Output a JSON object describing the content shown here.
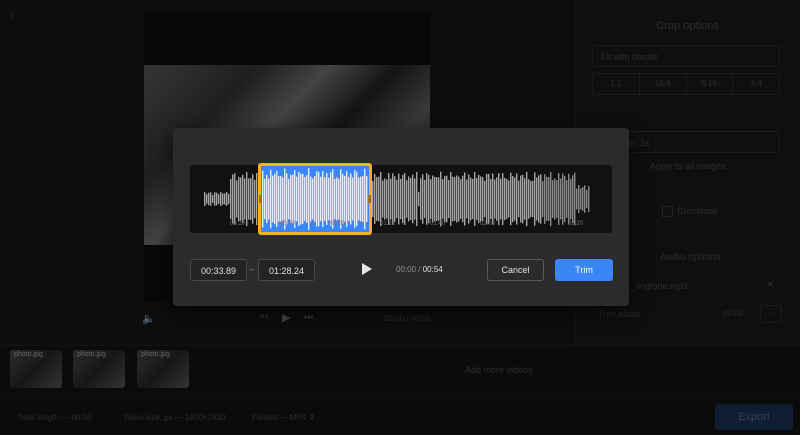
{
  "background": {
    "crop": {
      "title": "Crop options",
      "fit_select": "Fit with border",
      "ratios": [
        "1:1",
        "16:9",
        "9:16",
        "3:4"
      ]
    },
    "slide": {
      "duration_select": "Duration: 2s",
      "apply_all": "Apply to all images",
      "crossfade": "Crossfade"
    },
    "audio": {
      "title": "Audio options",
      "file": "Marimba_ringtone.mp3",
      "trim_row": "Trim audio",
      "trim_time": "00:00",
      "more_button": "..."
    },
    "player": {
      "current": "00:00",
      "total": "00:06"
    },
    "timeline": {
      "thumbs": [
        "photo.jpg",
        "photo.jpg",
        "photo.jpg"
      ],
      "add_more": "Add more videos"
    },
    "footer": {
      "total_length_label": "Total length —",
      "total_length": "00:06",
      "video_size_label": "Video size, px —",
      "video_size": "1920×1920",
      "format_label": "Format —",
      "format": "MP4",
      "export": "Export"
    }
  },
  "modal": {
    "waveform_ticks": [
      "00:20",
      "00:40",
      "01:00",
      "01:20",
      "01:40",
      "02:00",
      "02:20"
    ],
    "selection_fraction": [
      0.167,
      0.434
    ],
    "start_time": "00:33.89",
    "end_time": "01:28.24",
    "separator": "–",
    "current_time": "00:00",
    "time_separator": "/",
    "duration": "00:54",
    "cancel_label": "Cancel",
    "trim_label": "Trim",
    "colors": {
      "accent": "#3a86f7",
      "selection_border": "#f2b21c"
    }
  }
}
